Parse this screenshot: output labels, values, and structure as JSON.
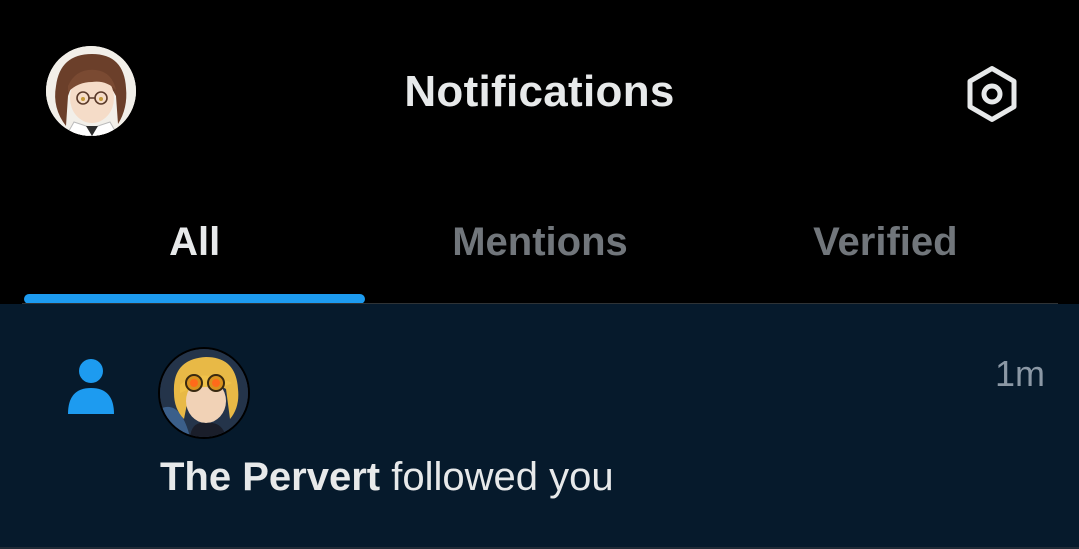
{
  "header": {
    "title": "Notifications",
    "profile_avatar_icon": "user-avatar",
    "settings_icon": "gear-icon"
  },
  "tabs": [
    {
      "label": "All",
      "active": true
    },
    {
      "label": "Mentions",
      "active": false
    },
    {
      "label": "Verified",
      "active": false
    }
  ],
  "notifications": [
    {
      "type_icon": "person-icon",
      "name": "The Pervert",
      "action": " followed you",
      "time": "1m"
    }
  ],
  "colors": {
    "background": "#000000",
    "accent": "#1d9bf0",
    "unread_background": "#061a2c",
    "text_primary": "#e7e9ea",
    "text_secondary": "#71767b"
  }
}
